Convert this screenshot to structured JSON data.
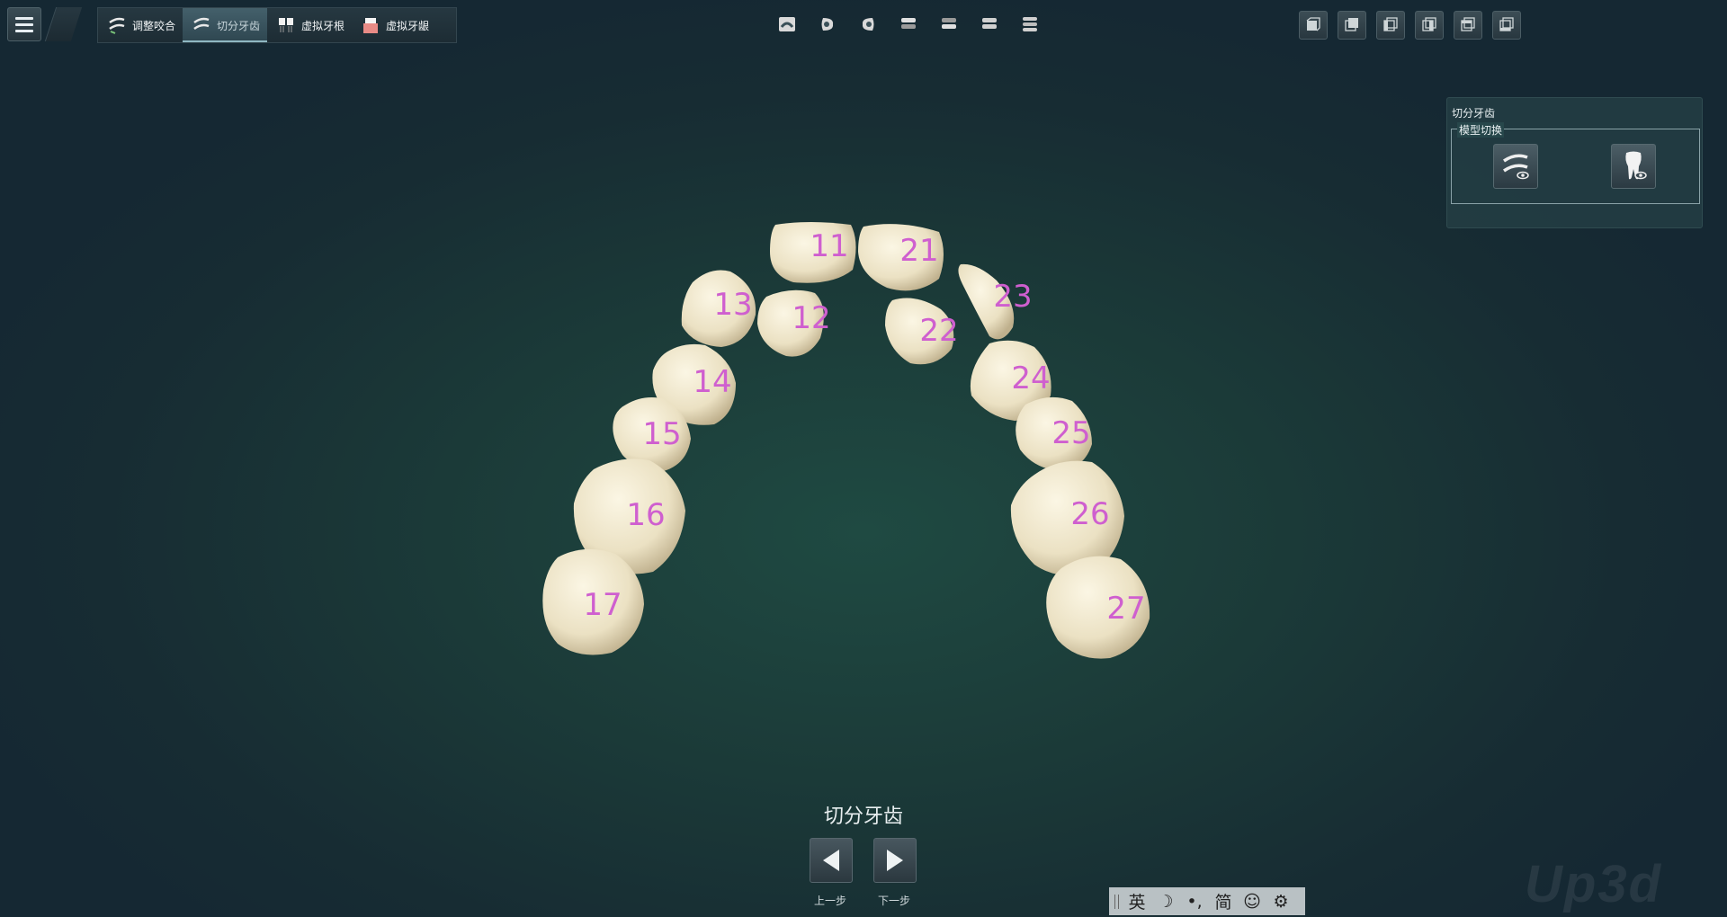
{
  "toolbar": {
    "tabs": [
      {
        "label": "调整咬合",
        "icon": "occlusion-icon"
      },
      {
        "label": "切分牙齿",
        "icon": "segment-teeth-icon",
        "active": true
      },
      {
        "label": "虚拟牙根",
        "icon": "virtual-root-icon"
      },
      {
        "label": "虚拟牙龈",
        "icon": "virtual-gum-icon"
      }
    ],
    "view_buttons": [
      "front-view-icon",
      "left-view-icon",
      "right-view-icon",
      "upper-jaw-icon",
      "lower-jaw-icon",
      "both-jaws-icon",
      "occlusal-view-icon"
    ],
    "display_buttons": [
      "solid-box-icon",
      "shaded-box-icon",
      "wire-box-icon",
      "front-box-icon",
      "side-box-icon",
      "back-box-icon"
    ]
  },
  "panel": {
    "title": "切分牙齿",
    "group_title": "模型切换",
    "buttons": [
      "jaw-model-toggle-icon",
      "tooth-model-toggle-icon"
    ]
  },
  "teeth": [
    "11",
    "12",
    "13",
    "14",
    "15",
    "16",
    "17",
    "21",
    "22",
    "23",
    "24",
    "25",
    "26",
    "27"
  ],
  "step": {
    "title": "切分牙齿",
    "prev_label": "上一步",
    "next_label": "下一步"
  },
  "ime": [
    "英",
    "☽",
    "•,",
    "简",
    "☺",
    "⚙"
  ],
  "watermark": "Up3d",
  "colors": {
    "tooth": "#efe6cc",
    "number": "#cf5fcf",
    "accent": "#8fb7c2"
  }
}
